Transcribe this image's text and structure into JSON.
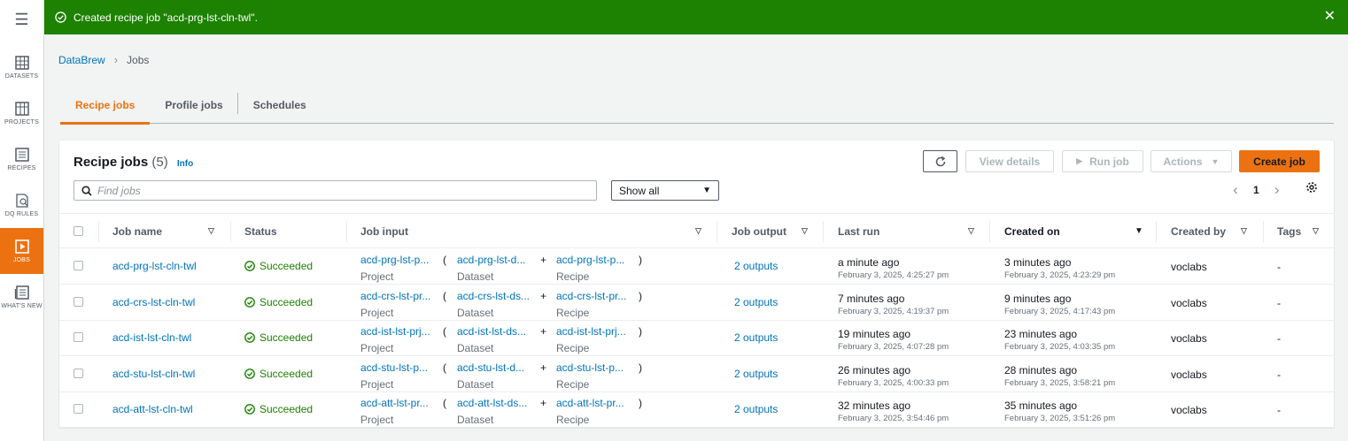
{
  "rail": {
    "items": [
      {
        "label": "DATASETS",
        "icon": "datasets-icon"
      },
      {
        "label": "PROJECTS",
        "icon": "projects-icon"
      },
      {
        "label": "RECIPES",
        "icon": "recipes-icon"
      },
      {
        "label": "DQ RULES",
        "icon": "dq-rules-icon"
      },
      {
        "label": "JOBS",
        "icon": "jobs-icon"
      },
      {
        "label": "WHAT'S NEW",
        "icon": "whats-new-icon"
      }
    ]
  },
  "flash": {
    "message": "Created recipe job \"acd-prg-lst-cln-twl\"."
  },
  "breadcrumb": {
    "root": "DataBrew",
    "current": "Jobs"
  },
  "tabs": [
    {
      "label": "Recipe jobs",
      "active": true
    },
    {
      "label": "Profile jobs",
      "active": false
    },
    {
      "label": "Schedules",
      "active": false
    }
  ],
  "panel": {
    "title": "Recipe jobs",
    "count": "(5)",
    "info": "Info",
    "buttons": {
      "view": "View details",
      "run": "Run job",
      "actions": "Actions",
      "create": "Create job"
    },
    "search_placeholder": "Find jobs",
    "filter": "Show all",
    "page": "1"
  },
  "columns": {
    "job_name": "Job name",
    "status": "Status",
    "job_input": "Job input",
    "job_output": "Job output",
    "last_run": "Last run",
    "created_on": "Created on",
    "created_by": "Created by",
    "tags": "Tags"
  },
  "colors": {
    "accent": "#ec7211",
    "success": "#1d8102",
    "link": "#0073bb"
  },
  "rows": [
    {
      "name": "acd-prg-lst-cln-twl",
      "status": "Succeeded",
      "in1": "acd-prg-lst-p...",
      "in1_type": "Project",
      "in2": "acd-prg-lst-d...",
      "in2_type": "Dataset",
      "in3": "acd-prg-lst-p...",
      "in3_type": "Recipe",
      "output": "2 outputs",
      "last_rel": "a minute ago",
      "last_abs": "February 3, 2025, 4:25:27 pm",
      "created_rel": "3 minutes ago",
      "created_abs": "February 3, 2025, 4:23:29 pm",
      "created_by": "voclabs",
      "tags": "-"
    },
    {
      "name": "acd-crs-lst-cln-twl",
      "status": "Succeeded",
      "in1": "acd-crs-lst-pr...",
      "in1_type": "Project",
      "in2": "acd-crs-lst-ds...",
      "in2_type": "Dataset",
      "in3": "acd-crs-lst-pr...",
      "in3_type": "Recipe",
      "output": "2 outputs",
      "last_rel": "7 minutes ago",
      "last_abs": "February 3, 2025, 4:19:37 pm",
      "created_rel": "9 minutes ago",
      "created_abs": "February 3, 2025, 4:17:43 pm",
      "created_by": "voclabs",
      "tags": "-"
    },
    {
      "name": "acd-ist-lst-cln-twl",
      "status": "Succeeded",
      "in1": "acd-ist-lst-prj...",
      "in1_type": "Project",
      "in2": "acd-ist-lst-ds...",
      "in2_type": "Dataset",
      "in3": "acd-ist-lst-prj...",
      "in3_type": "Recipe",
      "output": "2 outputs",
      "last_rel": "19 minutes ago",
      "last_abs": "February 3, 2025, 4:07:28 pm",
      "created_rel": "23 minutes ago",
      "created_abs": "February 3, 2025, 4:03:35 pm",
      "created_by": "voclabs",
      "tags": "-"
    },
    {
      "name": "acd-stu-lst-cln-twl",
      "status": "Succeeded",
      "in1": "acd-stu-lst-p...",
      "in1_type": "Project",
      "in2": "acd-stu-lst-d...",
      "in2_type": "Dataset",
      "in3": "acd-stu-lst-p...",
      "in3_type": "Recipe",
      "output": "2 outputs",
      "last_rel": "26 minutes ago",
      "last_abs": "February 3, 2025, 4:00:33 pm",
      "created_rel": "28 minutes ago",
      "created_abs": "February 3, 2025, 3:58:21 pm",
      "created_by": "voclabs",
      "tags": "-"
    },
    {
      "name": "acd-att-lst-cln-twl",
      "status": "Succeeded",
      "in1": "acd-att-lst-pr...",
      "in1_type": "Project",
      "in2": "acd-att-lst-ds...",
      "in2_type": "Dataset",
      "in3": "acd-att-lst-pr...",
      "in3_type": "Recipe",
      "output": "2 outputs",
      "last_rel": "32 minutes ago",
      "last_abs": "February 3, 2025, 3:54:46 pm",
      "created_rel": "35 minutes ago",
      "created_abs": "February 3, 2025, 3:51:26 pm",
      "created_by": "voclabs",
      "tags": "-"
    }
  ]
}
